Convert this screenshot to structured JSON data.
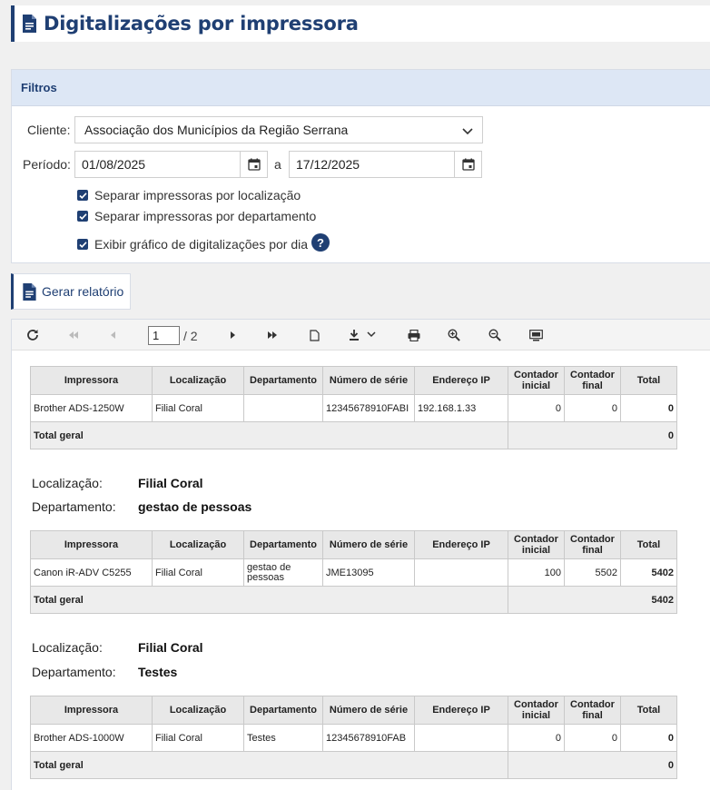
{
  "page": {
    "title": "Digitalizações por impressora"
  },
  "filters": {
    "title": "Filtros",
    "client_label": "Cliente:",
    "client_value": "Associação dos Municípios da Região Serrana",
    "period_label": "Período:",
    "date_from": "01/08/2025",
    "date_sep": "a",
    "date_to": "17/12/2025",
    "checkboxes": [
      {
        "label": "Separar impressoras por localização",
        "checked": true
      },
      {
        "label": "Separar impressoras por departamento",
        "checked": true
      },
      {
        "label": "Exibir gráfico de digitalizações por dia",
        "checked": true
      }
    ],
    "help_label": "?"
  },
  "actions": {
    "generate_label": "Gerar relatório"
  },
  "viewer": {
    "toolbar": {
      "icons": [
        "refresh-icon",
        "first-page-icon",
        "prev-page-icon",
        "next-page-icon",
        "last-page-icon",
        "document-icon",
        "download-icon",
        "print-icon",
        "zoom-in-icon",
        "zoom-out-icon",
        "fullscreen-icon"
      ],
      "page": "1",
      "page_total": "/ 2"
    },
    "columns": [
      "Impressora",
      "Localização",
      "Departamento",
      "Número de série",
      "Endereço IP",
      "Contador inicial",
      "Contador final",
      "Total"
    ],
    "location_label": "Localização:",
    "department_label": "Departamento:",
    "total_label": "Total geral",
    "sections": [
      {
        "location": "",
        "department": "",
        "rows": [
          {
            "printer": "Brother ADS-1250W",
            "location": "Filial Coral",
            "department": "",
            "serial": "12345678910FABI",
            "ip": "192.168.1.33",
            "start": "0",
            "end": "0",
            "total": "0"
          }
        ],
        "grand_total": "0"
      },
      {
        "location": "Filial Coral",
        "department": "gestao de pessoas",
        "rows": [
          {
            "printer": "Canon iR-ADV C5255",
            "location": "Filial Coral",
            "department": "gestao de pessoas",
            "serial": "JME13095",
            "ip": "",
            "start": "100",
            "end": "5502",
            "total": "5402"
          }
        ],
        "grand_total": "5402"
      },
      {
        "location": "Filial Coral",
        "department": "Testes",
        "rows": [
          {
            "printer": "Brother ADS-1000W",
            "location": "Filial Coral",
            "department": "Testes",
            "serial": "12345678910FAB",
            "ip": "",
            "start": "0",
            "end": "0",
            "total": "0"
          }
        ],
        "grand_total": "0"
      }
    ]
  }
}
